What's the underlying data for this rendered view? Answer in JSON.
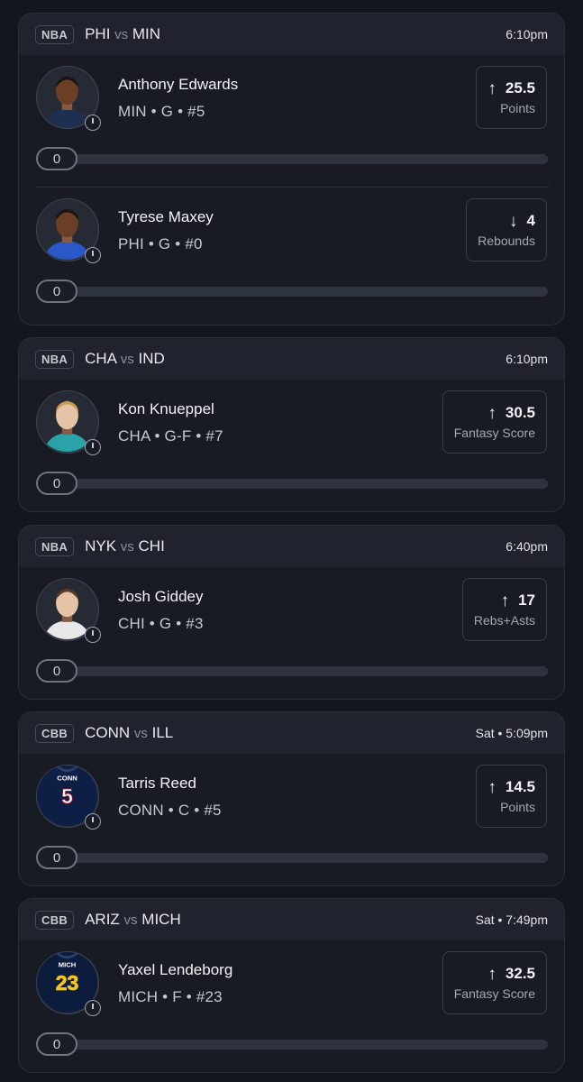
{
  "games": [
    {
      "league": "NBA",
      "home": "PHI",
      "vs": "vs",
      "away": "MIN",
      "time": "6:10pm",
      "players": [
        {
          "name": "Anthony Edwards",
          "meta": "MIN • G • #5",
          "direction": "up",
          "arrow": "↑",
          "line": "25.5",
          "stat": "Points",
          "progress": "0",
          "jersey_color": "#1f2f52"
        },
        {
          "name": "Tyrese Maxey",
          "meta": "PHI • G • #0",
          "direction": "down",
          "arrow": "↓",
          "line": "4",
          "stat": "Rebounds",
          "progress": "0",
          "jersey_color": "#2a58c7"
        }
      ]
    },
    {
      "league": "NBA",
      "home": "CHA",
      "vs": "vs",
      "away": "IND",
      "time": "6:10pm",
      "players": [
        {
          "name": "Kon Knueppel",
          "meta": "CHA • G-F • #7",
          "direction": "up",
          "arrow": "↑",
          "line": "30.5",
          "stat": "Fantasy Score",
          "progress": "0",
          "jersey_color": "#2aa3a8"
        }
      ]
    },
    {
      "league": "NBA",
      "home": "NYK",
      "vs": "vs",
      "away": "CHI",
      "time": "6:40pm",
      "players": [
        {
          "name": "Josh Giddey",
          "meta": "CHI • G • #3",
          "direction": "up",
          "arrow": "↑",
          "line": "17",
          "stat": "Rebs+Asts",
          "progress": "0",
          "jersey_color": "#e8e8ea"
        }
      ]
    },
    {
      "league": "CBB",
      "home": "CONN",
      "vs": "vs",
      "away": "ILL",
      "time": "Sat • 5:09pm",
      "players": [
        {
          "name": "Tarris Reed",
          "meta": "CONN • C • #5",
          "direction": "up",
          "arrow": "↑",
          "line": "14.5",
          "stat": "Points",
          "progress": "0",
          "jersey_color": "#0e1f45",
          "jersey_text": "CONN",
          "jersey_number": "5",
          "number_color": "#ffffff",
          "number_stroke": "#c8102e"
        }
      ]
    },
    {
      "league": "CBB",
      "home": "ARIZ",
      "vs": "vs",
      "away": "MICH",
      "time": "Sat • 7:49pm",
      "players": [
        {
          "name": "Yaxel Lendeborg",
          "meta": "MICH • F • #23",
          "direction": "up",
          "arrow": "↑",
          "line": "32.5",
          "stat": "Fantasy Score",
          "progress": "0",
          "jersey_color": "#0b1c3d",
          "jersey_text": "MICH",
          "jersey_number": "23",
          "number_color": "#f5c518",
          "number_stroke": "#f5c518"
        }
      ]
    }
  ]
}
